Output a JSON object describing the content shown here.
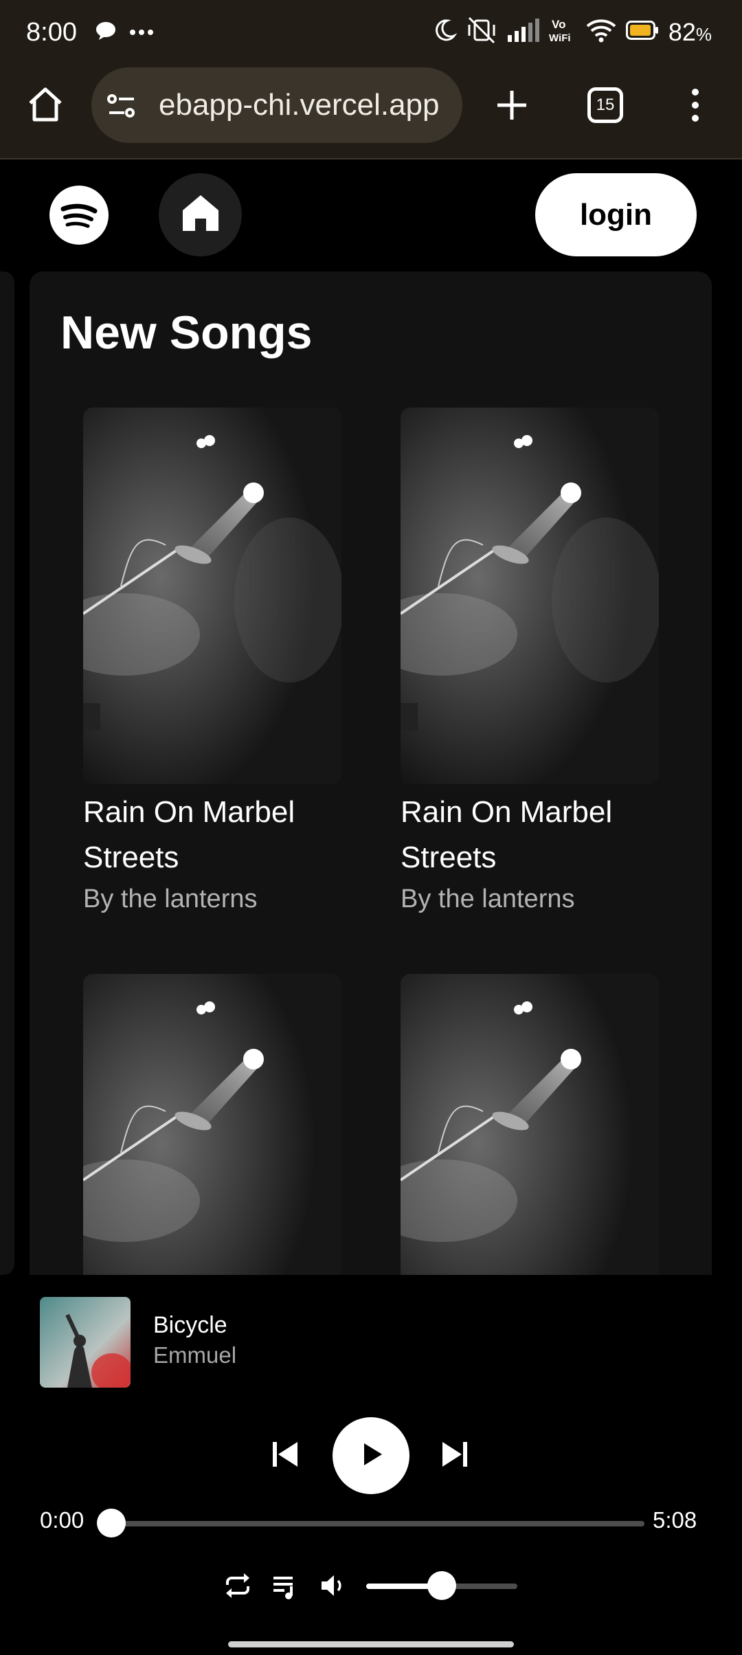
{
  "status_bar": {
    "time": "8:00",
    "battery_percent": "82",
    "battery_suffix": "%",
    "icons": [
      "chat-bubble-icon",
      "more-dots-icon",
      "moon-icon",
      "vibrate-off-icon",
      "signal-icon",
      "vowifi-icon",
      "wifi-icon",
      "battery-icon"
    ],
    "vowifi_label": "Vo\nWiFi"
  },
  "browser": {
    "url": "ebapp-chi.vercel.app",
    "tab_count": "15",
    "icons": [
      "home-icon",
      "site-settings-icon",
      "new-tab-icon",
      "tab-switcher-icon",
      "overflow-menu-icon"
    ]
  },
  "header": {
    "login_label": "login",
    "icons": [
      "spotify-logo-icon",
      "home-icon"
    ]
  },
  "main": {
    "section_title": "New Songs",
    "songs": [
      {
        "title": "Rain On Marbel Streets",
        "artist": "By the lanterns"
      },
      {
        "title": "Rain On Marbel Streets",
        "artist": "By the lanterns"
      },
      {
        "title": "",
        "artist": ""
      },
      {
        "title": "",
        "artist": ""
      }
    ]
  },
  "player": {
    "track_title": "Bicycle",
    "track_artist": "Emmuel",
    "time_current": "0:00",
    "time_total": "5:08",
    "progress_fraction": 0,
    "volume_fraction": 0.5,
    "icons": [
      "previous-icon",
      "play-icon",
      "next-icon",
      "repeat-icon",
      "queue-icon",
      "volume-icon"
    ]
  },
  "colors": {
    "browser_chrome": "#211c15",
    "panel": "#121212",
    "accent": "#ffffff",
    "battery": "#f2b320"
  }
}
